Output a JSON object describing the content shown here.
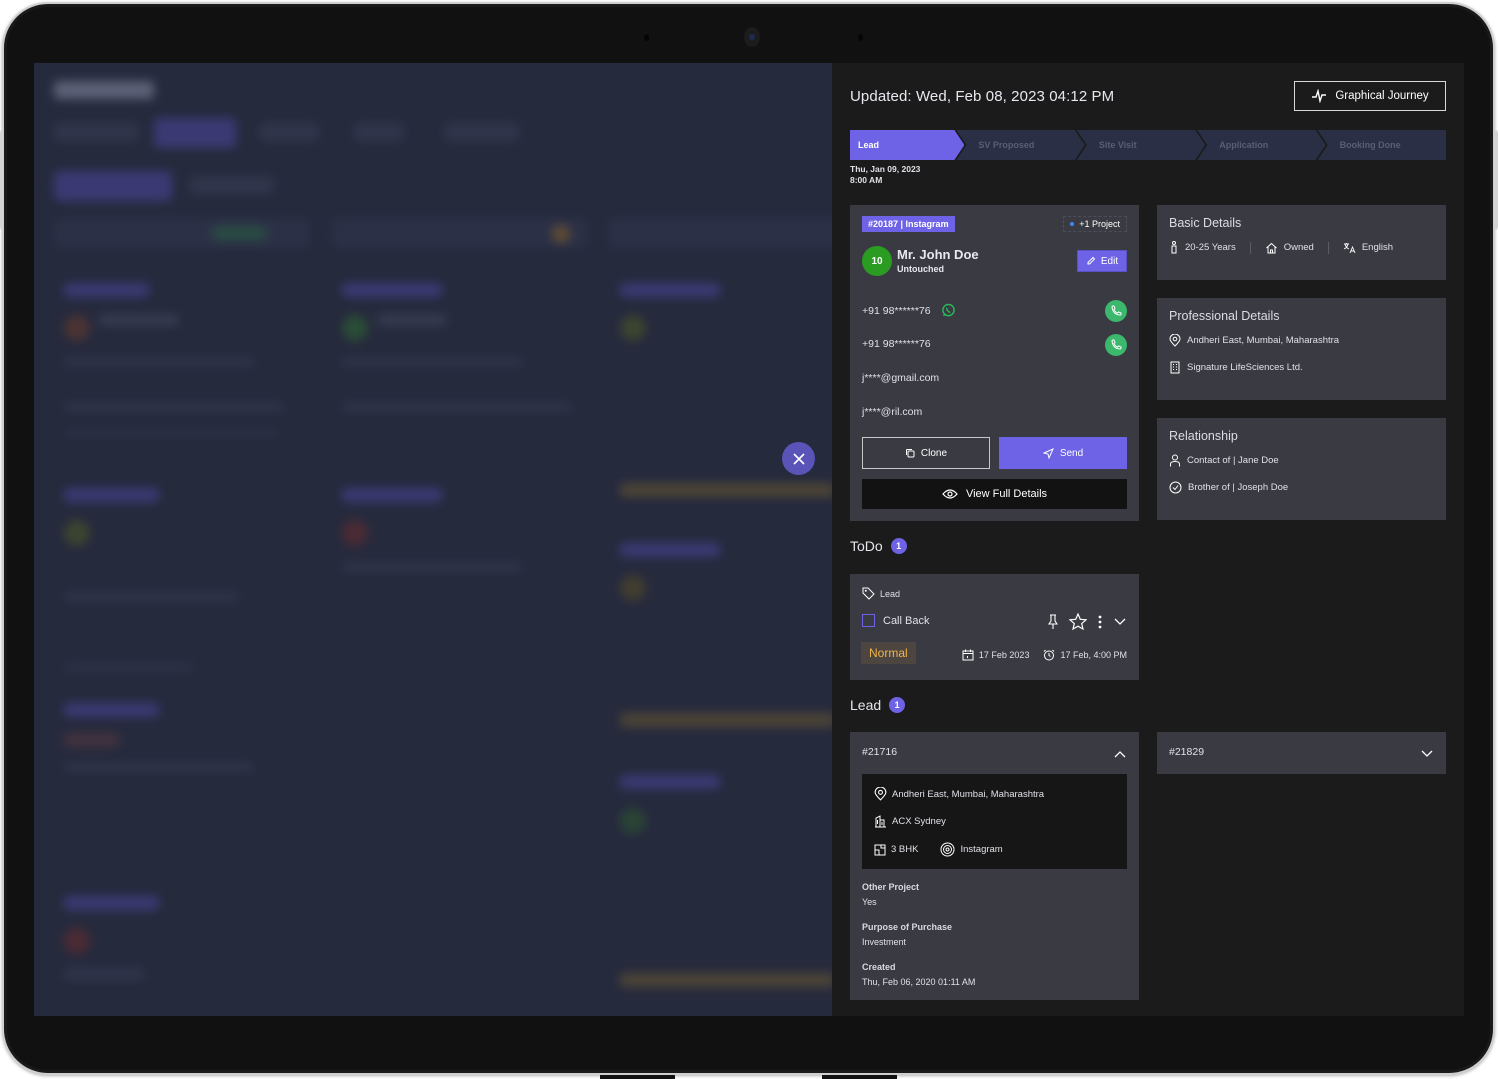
{
  "drawer": {
    "updated": "Updated: Wed, Feb 08, 2023  04:12 PM",
    "graphical_journey_label": "Graphical Journey",
    "close_icon": "close-icon",
    "stages": [
      {
        "label": "Lead",
        "active": true
      },
      {
        "label": "SV Proposed",
        "active": false
      },
      {
        "label": "Site Visit",
        "active": false
      },
      {
        "label": "Application",
        "active": false
      },
      {
        "label": "Booking Done",
        "active": false
      }
    ],
    "stage_date_line1": "Thu, Jan 09, 2023",
    "stage_date_line2": "8:00 AM"
  },
  "lead_card": {
    "id_source": "#20187 | Instagram",
    "project_tag": "+1 Project",
    "score": "10",
    "name": "Mr. John Doe",
    "status": "Untouched",
    "edit_label": "Edit",
    "phone1": "+91 98******76",
    "phone2": "+91 98******76",
    "email1": "j****@gmail.com",
    "email2": "j****@ril.com",
    "clone_label": "Clone",
    "send_label": "Send",
    "view_details_label": "View Full Details"
  },
  "basic_details": {
    "title": "Basic Details",
    "age": "20-25 Years",
    "residence": "Owned",
    "language": "English"
  },
  "professional_details": {
    "title": "Professional Details",
    "location": "Andheri East, Mumbai, Maharashtra",
    "company": "Signature LifeSciences Ltd."
  },
  "relationship": {
    "title": "Relationship",
    "rel1": "Contact of  |  Jane Doe",
    "rel2": "Brother of  | Joseph Doe"
  },
  "todo": {
    "title": "ToDo",
    "count": "1",
    "tag": "Lead",
    "task": "Call Back",
    "task_checked": false,
    "priority": "Normal",
    "date": "17 Feb 2023",
    "reminder": "17 Feb, 4:00 PM"
  },
  "leads": {
    "title": "Lead",
    "count": "1",
    "items": [
      {
        "id": "#21716",
        "expanded": true,
        "location": "Andheri East, Mumbai, Maharashtra",
        "project": "ACX Sydney",
        "config": "3 BHK",
        "source": "Instagram",
        "other_project_label": "Other Project",
        "other_project": "Yes",
        "purpose_label": "Purpose of Purchase",
        "purpose": "Investment",
        "created_label": "Created",
        "created": "Thu, Feb 06, 2020  01:11 AM"
      },
      {
        "id": "#21829",
        "expanded": false
      }
    ]
  },
  "colors": {
    "accent": "#6e63e6",
    "call_green": "#3bb86b",
    "score_green": "#2a9c22",
    "priority_text": "#f0b44a",
    "drawer_bg": "#1b1b1b",
    "card_bg": "#3a3b42"
  }
}
